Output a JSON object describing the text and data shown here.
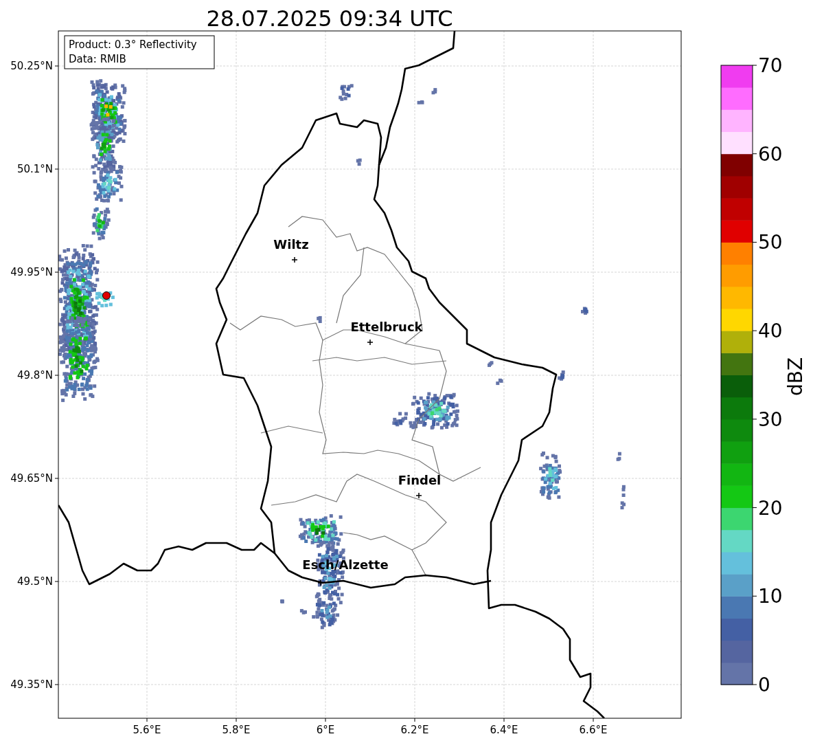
{
  "title": "28.07.2025 09:34 UTC",
  "info_box": [
    "Product: 0.3° Reflectivity",
    "Data: RMIB"
  ],
  "cities": [
    {
      "name": "Wiltz"
    },
    {
      "name": "Ettelbruck"
    },
    {
      "name": "Findel"
    },
    {
      "name": "Esch/Alzette"
    }
  ],
  "x_ticks": [
    "5.6°E",
    "5.8°E",
    "6°E",
    "6.2°E",
    "6.4°E",
    "6.6°E"
  ],
  "y_ticks": [
    "50.25°N",
    "50.1°N",
    "49.95°N",
    "49.8°N",
    "49.65°N",
    "49.5°N",
    "49.35°N"
  ],
  "colorbar": {
    "label": "dBZ",
    "ticks": [
      "70",
      "60",
      "50",
      "40",
      "30",
      "20",
      "10",
      "0"
    ],
    "bins": [
      {
        "color": "#6474a8"
      },
      {
        "color": "#5565a0"
      },
      {
        "color": "#4460a4"
      },
      {
        "color": "#4a78b2"
      },
      {
        "color": "#5aa0c8"
      },
      {
        "color": "#64c0dc"
      },
      {
        "color": "#64d8c4"
      },
      {
        "color": "#3cd670"
      },
      {
        "color": "#14c814"
      },
      {
        "color": "#12b612"
      },
      {
        "color": "#10a010"
      },
      {
        "color": "#0e8a0e"
      },
      {
        "color": "#0c7a0c"
      },
      {
        "color": "#0a5e0a"
      },
      {
        "color": "#437510"
      },
      {
        "color": "#b0b00a"
      },
      {
        "color": "#ffd700"
      },
      {
        "color": "#ffb800"
      },
      {
        "color": "#ff9c00"
      },
      {
        "color": "#ff8000"
      },
      {
        "color": "#e00000"
      },
      {
        "color": "#c00000"
      },
      {
        "color": "#a00000"
      },
      {
        "color": "#800000"
      },
      {
        "color": "#ffe0ff"
      },
      {
        "color": "#ffb4ff"
      },
      {
        "color": "#ff6cff"
      },
      {
        "color": "#f03cf0"
      }
    ]
  }
}
